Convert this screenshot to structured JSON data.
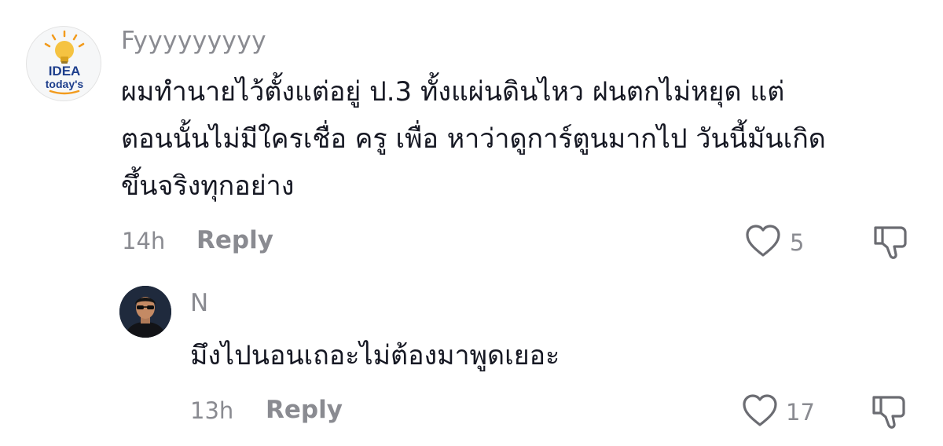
{
  "comment": {
    "avatar": {
      "logo_top": "IDEA",
      "logo_bottom": "today's",
      "colors": {
        "bulb": "#f5c342",
        "idea_text": "#1d3e8c",
        "accent": "#f29b1d"
      }
    },
    "username": "Fyyyyyyyyy",
    "text_lines": [
      "ผมทำนายไว้ตั้งแต่อยู่ ป.3 ทั้งแผ่นดินไหว ฝนตกไม่หยุด แต่",
      "ตอนนั้นไม่มีใครเชื่อ ครู เพื่อ หาว่าดูการ์ตูนมากไป วันนี้มันเกิด",
      "ขึ้นจริงทุกอย่าง"
    ],
    "time": "14h",
    "reply_label": "Reply",
    "like_count": "5",
    "like_icon": "heart-outline-icon",
    "dislike_icon": "thumbs-down-outline-icon"
  },
  "reply": {
    "username": "N",
    "text": "มึงไปนอนเถอะไม่ต้องมาพูดเยอะ",
    "time": "13h",
    "reply_label": "Reply",
    "like_count": "17",
    "like_icon": "heart-outline-icon",
    "dislike_icon": "thumbs-down-outline-icon"
  },
  "colors": {
    "primary_text": "#161823",
    "secondary_text": "#8a8b91",
    "icon": "#6b6c72"
  }
}
